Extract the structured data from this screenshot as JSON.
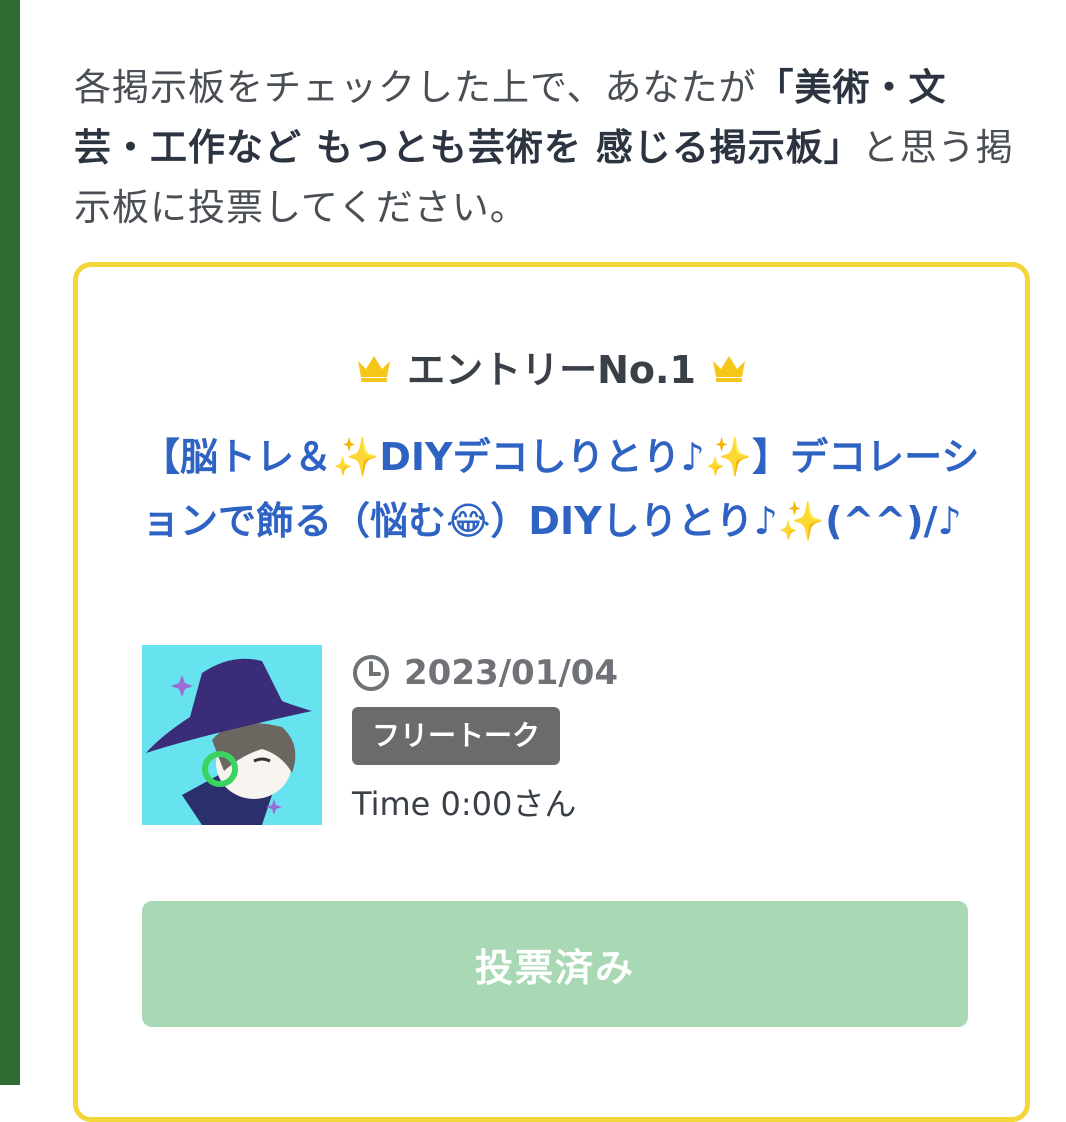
{
  "intro": {
    "text_before": "各掲示板をチェックした上で、あなたが",
    "highlight": "「美術・文芸・工作など もっとも芸術を 感じる掲示板」",
    "text_after": "と思う掲示板に投票してください。"
  },
  "entry": {
    "heading": "エントリーNo.1",
    "title": "【脳トレ＆✨DIYデコしりとり♪✨】デコレーションで飾る（悩む😂）DIYしりとり♪✨(^^)/♪",
    "date": "2023/01/04",
    "category": "フリートーク",
    "author": "Time 0:00さん",
    "vote_button_label": "投票済み"
  },
  "colors": {
    "sidebar_green": "#2f6b33",
    "card_border_yellow": "#f3d63a",
    "title_blue": "#2f63c3",
    "button_green_disabled": "#a8d8b4"
  }
}
